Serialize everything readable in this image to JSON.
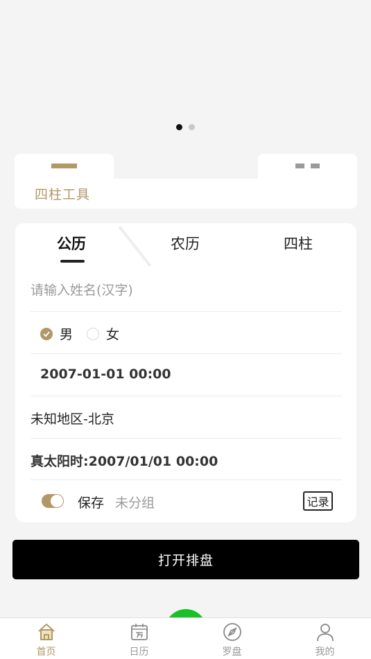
{
  "colors": {
    "accent": "#b29866",
    "primary_button": "#000000",
    "fab": "#19c127",
    "background": "#f4f4f4"
  },
  "carousel": {
    "page_count": 2,
    "active_index": 0
  },
  "tool_panel": {
    "label": "四柱工具"
  },
  "form": {
    "tabs": [
      {
        "label": "公历",
        "active": true
      },
      {
        "label": "农历",
        "active": false
      },
      {
        "label": "四柱",
        "active": false
      }
    ],
    "name_placeholder": "请输入姓名(汉字)",
    "name_value": "",
    "gender": {
      "options": [
        {
          "label": "男",
          "checked": true
        },
        {
          "label": "女",
          "checked": false
        }
      ]
    },
    "datetime": "2007-01-01 00:00",
    "place": "未知地区-北京",
    "true_solar_time": "真太阳时:2007/01/01 00:00",
    "save_toggle_on": true,
    "save_label": "保存",
    "group_label": "未分组",
    "record_button": "记录"
  },
  "primary_button": {
    "label": "打开排盘"
  },
  "bottom_nav": {
    "items": [
      {
        "label": "首页",
        "icon": "home-icon",
        "active": true
      },
      {
        "label": "日历",
        "icon": "calendar-icon",
        "active": false
      },
      {
        "label": "罗盘",
        "icon": "compass-icon",
        "active": false
      },
      {
        "label": "我的",
        "icon": "user-icon",
        "active": false
      }
    ]
  }
}
